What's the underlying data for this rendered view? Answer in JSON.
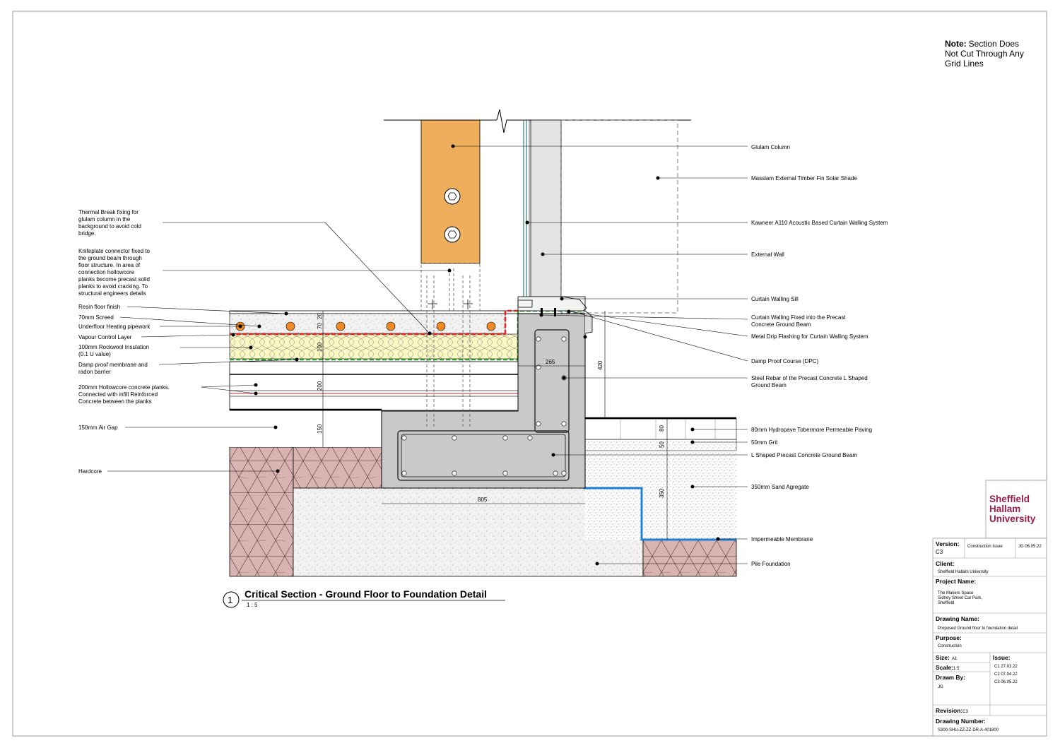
{
  "note": {
    "bold": "Note:",
    "lines": [
      "Section Does",
      "Not Cut Through Any",
      "Grid Lines"
    ]
  },
  "title": {
    "number": "1",
    "text": "Critical Section - Ground Floor to Foundation Detail",
    "scale": "1 : 5"
  },
  "labels_left": [
    {
      "id": "thermal-break",
      "lines": [
        "Thermal Break fixing for",
        "glulam column in the",
        "background to avoid cold",
        "bridge."
      ]
    },
    {
      "id": "knifeplate",
      "lines": [
        "Knifeplate connector fixed to",
        "the ground beam through",
        "floor structure. In area of",
        "connection hollowcore",
        "planks become precast solid",
        "planks to avoid cracking. To",
        "structural engineers details"
      ]
    },
    {
      "id": "resin",
      "lines": [
        "Resin floor finish"
      ]
    },
    {
      "id": "screed",
      "lines": [
        "70mm Screed"
      ]
    },
    {
      "id": "ufh",
      "lines": [
        "Underfloor Heating pipework"
      ]
    },
    {
      "id": "vcl",
      "lines": [
        "Vapour Control Layer"
      ]
    },
    {
      "id": "rockwool",
      "lines": [
        "100mm Rockwool Insulation",
        "(0.1 U value)"
      ]
    },
    {
      "id": "dpm",
      "lines": [
        "Damp proof membrane and",
        "radon barrier"
      ]
    },
    {
      "id": "hollowcore",
      "lines": [
        "200mm Hollowcore concrete planks.",
        "Connected with infill Reinforced",
        "Concrete between the planks"
      ]
    },
    {
      "id": "air-gap",
      "lines": [
        "150mm Air Gap"
      ]
    },
    {
      "id": "hardcore",
      "lines": [
        "Hardcore"
      ]
    }
  ],
  "labels_right": [
    {
      "id": "glulam",
      "lines": [
        "Glulam Column"
      ]
    },
    {
      "id": "masslam",
      "lines": [
        "Masslam External Timber Fin Solar Shade"
      ]
    },
    {
      "id": "kawneer",
      "lines": [
        "Kawneer A110 Acoustic Based Curtain Walling System"
      ]
    },
    {
      "id": "ext-wall",
      "lines": [
        "External Wall"
      ]
    },
    {
      "id": "cw-sill",
      "lines": [
        "Curtain Walling Sill"
      ]
    },
    {
      "id": "cw-fixed",
      "lines": [
        "Curtain Walling Fixed into the Precast",
        "Concrete Ground Beam"
      ]
    },
    {
      "id": "drip",
      "lines": [
        "Metal Drip Flashing for Curtain Walling System"
      ]
    },
    {
      "id": "dpc",
      "lines": [
        "Damp Proof Course (DPC)"
      ]
    },
    {
      "id": "rebar",
      "lines": [
        "Steel Rebar of the Precast Concrete L Shaped",
        "Ground Beam"
      ]
    },
    {
      "id": "paving",
      "lines": [
        "80mm Hydropave Tobermore Permeable Paving"
      ]
    },
    {
      "id": "grit",
      "lines": [
        "50mm Grit"
      ]
    },
    {
      "id": "l-beam",
      "lines": [
        "L Shaped Precast Concrete Ground Beam"
      ]
    },
    {
      "id": "sand",
      "lines": [
        "350mm Sand Agregate"
      ]
    },
    {
      "id": "membrane",
      "lines": [
        "Impermeable Membrane"
      ]
    },
    {
      "id": "pile",
      "lines": [
        "Pile Foundation"
      ]
    }
  ],
  "dimensions": {
    "d20": "20",
    "d70": "70",
    "d100": "100",
    "d200": "200",
    "d150": "150",
    "d265": "265",
    "d420": "420",
    "d805": "805",
    "d80": "80",
    "d50": "50",
    "d350": "350"
  },
  "title_block": {
    "logo": [
      "Sheffield",
      "Hallam",
      "University"
    ],
    "version_label": "Version:",
    "version": "C3",
    "version_desc": "Construction Issue",
    "version_date": "JG 06.05.22",
    "client_label": "Client:",
    "client": "Sheffield Hallam University",
    "project_label": "Project Name:",
    "project": [
      "The Makers Space",
      "Sidney Street Car Park,",
      "Sheffield"
    ],
    "drawing_name_label": "Drawing Name:",
    "drawing_name": "Proposed Ground floor to foundation detail",
    "purpose_label": "Purpose:",
    "purpose": "Construction",
    "size_label": "Size:",
    "size": "A1",
    "scale_label": "Scale:",
    "scale": "1:5",
    "issue_label": "Issue:",
    "issues": [
      "C1 27.03.22",
      "C2 07.04.22",
      "C3 06.05.22"
    ],
    "drawn_by_label": "Drawn By:",
    "drawn_by": "JG",
    "revision_label": "Revision:",
    "revision": "C3",
    "drawing_number_label": "Drawing Number:",
    "drawing_number": "S300-SHU-ZZ-ZZ-DR-A-401800"
  },
  "colors": {
    "glulam": "#efae5c",
    "insulation": "#fbf8c4",
    "hardcore": "#d9b3b1",
    "concrete": "#c9c9c9",
    "pipe": "#f08a24",
    "dpc_red": "#e8201c",
    "dpc_green": "#2c9a2c",
    "membrane_blue": "#1e7fd4",
    "logo": "#9c1d4a"
  }
}
